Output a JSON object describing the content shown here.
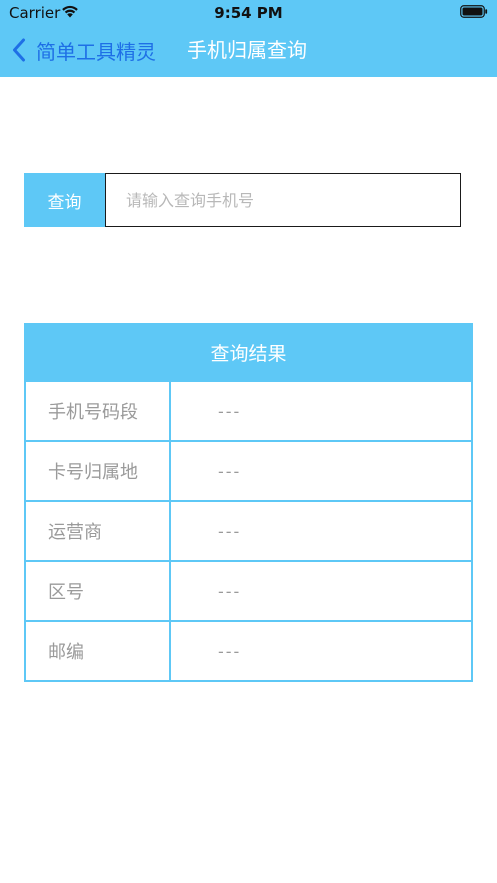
{
  "status_bar": {
    "carrier": "Carrier",
    "time": "9:54 PM"
  },
  "nav": {
    "back_label": "简单工具精灵",
    "title": "手机归属查询"
  },
  "query": {
    "button_label": "查询",
    "input_placeholder": "请输入查询手机号",
    "input_value": ""
  },
  "result": {
    "header": "查询结果",
    "rows": [
      {
        "label": "手机号码段",
        "value": "---"
      },
      {
        "label": "卡号归属地",
        "value": "---"
      },
      {
        "label": "运营商",
        "value": "---"
      },
      {
        "label": "区号",
        "value": "---"
      },
      {
        "label": "邮编",
        "value": "---"
      }
    ]
  },
  "colors": {
    "accent": "#5ec8f6",
    "back_link": "#1e6fe6",
    "muted_text": "#9a9a9a"
  }
}
